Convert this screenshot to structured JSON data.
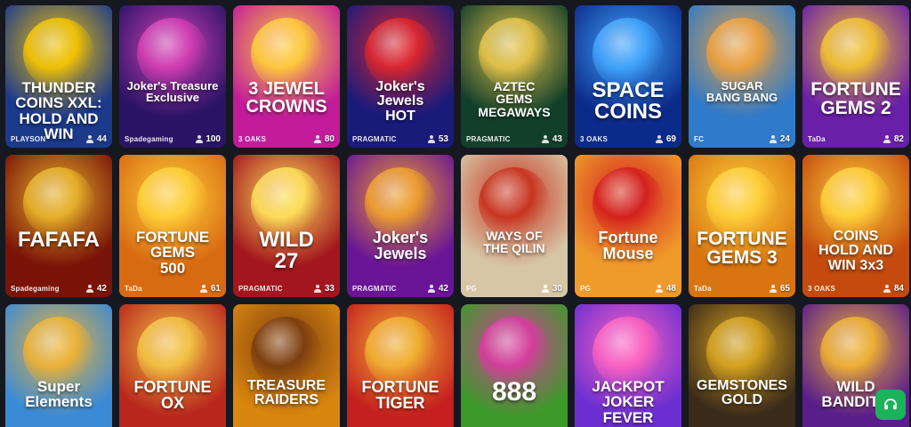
{
  "games": [
    {
      "name": "THUNDER\nCOINS XXL:\nHOLD AND WIN",
      "provider": "PLAYSON",
      "players": "44",
      "bg": "#1c3a8c",
      "accent": "#f5c400",
      "size": 17
    },
    {
      "name": "Joker's Treasure\nExclusive",
      "provider": "Spadegaming",
      "players": "100",
      "bg": "#2a1466",
      "accent": "#d63fb5",
      "size": 13
    },
    {
      "name": "3 JEWEL\nCROWNS",
      "provider": "3 OAKS",
      "players": "80",
      "bg": "#c21c9a",
      "accent": "#ffce3a",
      "size": 20
    },
    {
      "name": "Joker's\nJewels\nHOT",
      "provider": "PRAGMATIC",
      "players": "53",
      "bg": "#1a1a7a",
      "accent": "#e0262c",
      "size": 16
    },
    {
      "name": "AZTEC\nGEMS\nMEGAWAYS",
      "provider": "PRAGMATIC",
      "players": "43",
      "bg": "#123f2a",
      "accent": "#e7c44a",
      "size": 14
    },
    {
      "name": "SPACE\nCOINS",
      "provider": "3 OAKS",
      "players": "69",
      "bg": "#0b2b8a",
      "accent": "#41a7ff",
      "size": 24
    },
    {
      "name": "SUGAR\nBANG BANG",
      "provider": "FC",
      "players": "24",
      "bg": "#2f7ac9",
      "accent": "#f0a13b",
      "size": 13
    },
    {
      "name": "FORTUNE\nGEMS 2",
      "provider": "TaDa",
      "players": "82",
      "bg": "#6a1fa8",
      "accent": "#f2c230",
      "size": 21
    },
    {
      "name": "FAFAFA",
      "provider": "Spadegaming",
      "players": "42",
      "bg": "#7a1408",
      "accent": "#e8b42a",
      "size": 24
    },
    {
      "name": "FORTUNE GEMS\n500",
      "provider": "TaDa",
      "players": "61",
      "bg": "#d86a12",
      "accent": "#ffd23a",
      "size": 17
    },
    {
      "name": "WILD\n27",
      "provider": "PRAGMATIC",
      "players": "33",
      "bg": "#a3161e",
      "accent": "#ffe15a",
      "size": 24
    },
    {
      "name": "Joker's\nJewels",
      "provider": "PRAGMATIC",
      "players": "42",
      "bg": "#6a1596",
      "accent": "#f0a02a",
      "size": 18
    },
    {
      "name": "WAYS OF\nTHE QILIN",
      "provider": "PG",
      "players": "30",
      "bg": "#d6c6a6",
      "accent": "#c7301c",
      "size": 14
    },
    {
      "name": "Fortune\nMouse",
      "provider": "PG",
      "players": "48",
      "bg": "#ef9b2c",
      "accent": "#d31d1d",
      "size": 18
    },
    {
      "name": "FORTUNE\nGEMS 3",
      "provider": "TaDa",
      "players": "65",
      "bg": "#d87512",
      "accent": "#ffd23a",
      "size": 21
    },
    {
      "name": "COINS\nHOLD AND WIN 3x3",
      "provider": "3 OAKS",
      "players": "84",
      "bg": "#c44a0d",
      "accent": "#ffd23a",
      "size": 16
    },
    {
      "name": "Super\nElements",
      "provider": "",
      "players": "",
      "bg": "#3a8ad6",
      "accent": "#f0b232",
      "size": 17
    },
    {
      "name": "FORTUNE\nOX",
      "provider": "",
      "players": "",
      "bg": "#b8261c",
      "accent": "#f3c444",
      "size": 18
    },
    {
      "name": "TREASURE\nRAIDERS",
      "provider": "",
      "players": "",
      "bg": "#d9860f",
      "accent": "#7a3c0f",
      "size": 16
    },
    {
      "name": "FORTUNE\nTIGER",
      "provider": "",
      "players": "",
      "bg": "#c51f1f",
      "accent": "#f0b232",
      "size": 18
    },
    {
      "name": "888",
      "provider": "",
      "players": "",
      "bg": "#3d9a2a",
      "accent": "#d93aa0",
      "size": 30
    },
    {
      "name": "JACKPOT\nJOKER\nFEVER",
      "provider": "",
      "players": "",
      "bg": "#6b2fd1",
      "accent": "#ff62c0",
      "size": 17
    },
    {
      "name": "GEMSTONES\nGOLD",
      "provider": "",
      "players": "",
      "bg": "#3a2a1a",
      "accent": "#d9a41e",
      "size": 16
    },
    {
      "name": "WILD\nBANDITO",
      "provider": "",
      "players": "",
      "bg": "#5a1e8a",
      "accent": "#f0b232",
      "size": 17
    }
  ],
  "help_button": {
    "label": "headset"
  }
}
